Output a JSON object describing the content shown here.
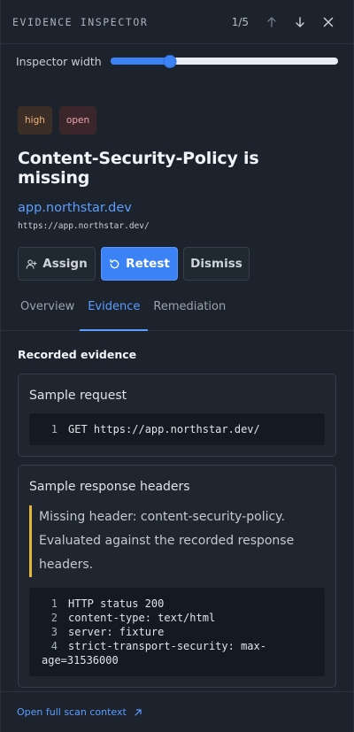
{
  "header": {
    "title": "EVIDENCE INSPECTOR",
    "pager": "1/5",
    "icons": {
      "prev": "arrow-up-icon",
      "next": "arrow-down-icon",
      "close": "close-icon"
    }
  },
  "width_control": {
    "label": "Inspector width",
    "value_fraction": 0.26
  },
  "finding": {
    "badges": {
      "severity": "high",
      "status": "open"
    },
    "title": "Content-Security-Policy is missing",
    "host": "app.northstar.dev",
    "url": "https://app.northstar.dev/"
  },
  "actions": {
    "assign": "Assign",
    "retest": "Retest",
    "dismiss": "Dismiss"
  },
  "tabs": [
    {
      "label": "Overview"
    },
    {
      "label": "Evidence"
    },
    {
      "label": "Remediation"
    }
  ],
  "active_tab": "Evidence",
  "evidence": {
    "section_title": "Recorded evidence",
    "request_card": {
      "title": "Sample request",
      "lines": [
        {
          "n": "1",
          "text": "GET https://app.northstar.dev/"
        }
      ]
    },
    "response_card": {
      "title": "Sample response headers",
      "note": "Missing header: content-security-policy. Evaluated against the recorded response headers.",
      "lines": [
        {
          "n": "1",
          "text": "HTTP status 200"
        },
        {
          "n": "2",
          "text": "content-type: text/html"
        },
        {
          "n": "3",
          "text": "server: fixture"
        },
        {
          "n": "4",
          "text": "strict-transport-security: max-",
          "cont": "age=31536000"
        }
      ]
    }
  },
  "footer": {
    "link": "Open full scan context"
  },
  "colors": {
    "accent": "#3b82f6",
    "link": "#5c9dff",
    "warning_border": "#e2b53b",
    "background": "#1c232d"
  }
}
